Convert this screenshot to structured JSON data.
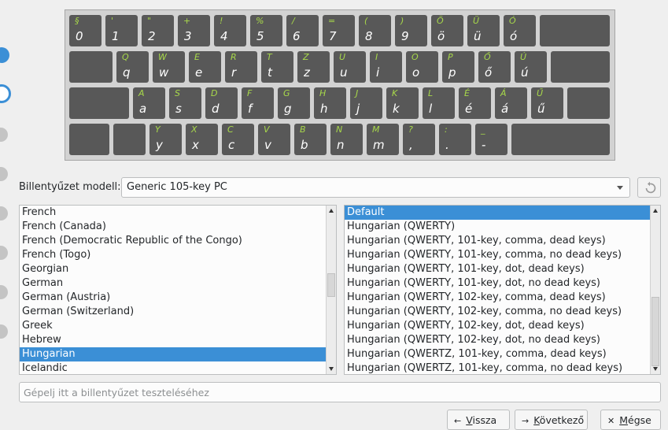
{
  "keyboard": {
    "rows": [
      [
        {
          "u": "§",
          "l": "0"
        },
        {
          "u": "'",
          "l": "1"
        },
        {
          "u": "\"",
          "l": "2"
        },
        {
          "u": "+",
          "l": "3"
        },
        {
          "u": "!",
          "l": "4"
        },
        {
          "u": "%",
          "l": "5"
        },
        {
          "u": "/",
          "l": "6"
        },
        {
          "u": "=",
          "l": "7"
        },
        {
          "u": "(",
          "l": "8"
        },
        {
          "u": ")",
          "l": "9"
        },
        {
          "u": "Ö",
          "l": "ö"
        },
        {
          "u": "Ü",
          "l": "ü"
        },
        {
          "u": "Ó",
          "l": "ó"
        },
        {
          "u": "",
          "l": ""
        }
      ],
      [
        {
          "u": "",
          "l": ""
        },
        {
          "u": "Q",
          "l": "q"
        },
        {
          "u": "W",
          "l": "w"
        },
        {
          "u": "E",
          "l": "e"
        },
        {
          "u": "R",
          "l": "r"
        },
        {
          "u": "T",
          "l": "t"
        },
        {
          "u": "Z",
          "l": "z"
        },
        {
          "u": "U",
          "l": "u"
        },
        {
          "u": "I",
          "l": "i"
        },
        {
          "u": "O",
          "l": "o"
        },
        {
          "u": "P",
          "l": "p"
        },
        {
          "u": "Ő",
          "l": "ő"
        },
        {
          "u": "Ú",
          "l": "ú"
        },
        {
          "u": "",
          "l": ""
        }
      ],
      [
        {
          "u": "",
          "l": ""
        },
        {
          "u": "A",
          "l": "a"
        },
        {
          "u": "S",
          "l": "s"
        },
        {
          "u": "D",
          "l": "d"
        },
        {
          "u": "F",
          "l": "f"
        },
        {
          "u": "G",
          "l": "g"
        },
        {
          "u": "H",
          "l": "h"
        },
        {
          "u": "J",
          "l": "j"
        },
        {
          "u": "K",
          "l": "k"
        },
        {
          "u": "L",
          "l": "l"
        },
        {
          "u": "É",
          "l": "é"
        },
        {
          "u": "Á",
          "l": "á"
        },
        {
          "u": "Ű",
          "l": "ű"
        },
        {
          "u": "",
          "l": ""
        }
      ],
      [
        {
          "u": "",
          "l": ""
        },
        {
          "u": "",
          "l": ""
        },
        {
          "u": "Y",
          "l": "y"
        },
        {
          "u": "X",
          "l": "x"
        },
        {
          "u": "C",
          "l": "c"
        },
        {
          "u": "V",
          "l": "v"
        },
        {
          "u": "B",
          "l": "b"
        },
        {
          "u": "N",
          "l": "n"
        },
        {
          "u": "M",
          "l": "m"
        },
        {
          "u": "?",
          "l": ","
        },
        {
          "u": ":",
          "l": "."
        },
        {
          "u": "_",
          "l": "-"
        },
        {
          "u": "",
          "l": ""
        }
      ]
    ]
  },
  "model": {
    "label": "Billentyűzet modell:",
    "value": "Generic 105-key PC"
  },
  "layouts": {
    "items": [
      "French",
      "French (Canada)",
      "French (Democratic Republic of the Congo)",
      "French (Togo)",
      "Georgian",
      "German",
      "German (Austria)",
      "German (Switzerland)",
      "Greek",
      "Hebrew",
      "Hungarian",
      "Icelandic"
    ],
    "selected": "Hungarian"
  },
  "variants": {
    "items": [
      "Default",
      "Hungarian (QWERTY)",
      "Hungarian (QWERTY, 101-key, comma, dead keys)",
      "Hungarian (QWERTY, 101-key, comma, no dead keys)",
      "Hungarian (QWERTY, 101-key, dot, dead keys)",
      "Hungarian (QWERTY, 101-key, dot, no dead keys)",
      "Hungarian (QWERTY, 102-key, comma, dead keys)",
      "Hungarian (QWERTY, 102-key, comma, no dead keys)",
      "Hungarian (QWERTY, 102-key, dot, dead keys)",
      "Hungarian (QWERTY, 102-key, dot, no dead keys)",
      "Hungarian (QWERTZ, 101-key, comma, dead keys)",
      "Hungarian (QWERTZ, 101-key, comma, no dead keys)"
    ],
    "selected": "Default"
  },
  "test_input": {
    "placeholder": "Gépelj itt a billentyűzet teszteléséhez",
    "value": ""
  },
  "buttons": {
    "back": {
      "pre": "",
      "acc": "V",
      "post": "issza",
      "icon": "arrow-left-icon"
    },
    "next": {
      "pre": "",
      "acc": "K",
      "post": "övetkező",
      "icon": "arrow-right-icon"
    },
    "cancel": {
      "pre": "",
      "acc": "M",
      "post": "égse",
      "icon": "close-icon"
    }
  },
  "colors": {
    "accent": "#3b8fd6",
    "key_bg": "#585858",
    "key_shift_label": "#a8d94a"
  }
}
